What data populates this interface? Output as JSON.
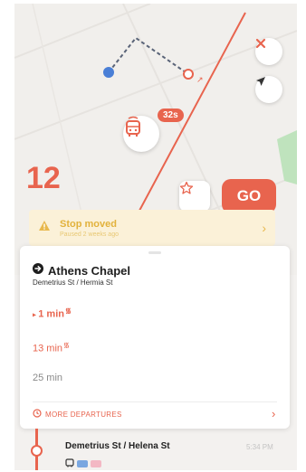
{
  "route": {
    "number": "12"
  },
  "map": {
    "eta_badge": "32s",
    "icons": [
      "close-icon",
      "navigation-arrow-icon",
      "bus-icon"
    ]
  },
  "actions": {
    "go_label": "GO",
    "favorite_icon": "star-icon"
  },
  "alert": {
    "title": "Stop moved",
    "subtitle": "Paused 2 weeks ago",
    "icon": "warning-icon"
  },
  "stop": {
    "name": "Athens Chapel",
    "cross_streets": "Demetrius St / Hermia St",
    "icon": "arrow-circle-icon"
  },
  "departures": [
    {
      "time": "1 min",
      "realtime": true
    },
    {
      "time": "13 min",
      "realtime": true
    },
    {
      "time": "25 min",
      "realtime": false
    }
  ],
  "more_departures": {
    "label": "MORE DEPARTURES",
    "icon": "clock-icon"
  },
  "next_stop": {
    "name": "Demetrius St / Helena St",
    "time": "5:34 PM",
    "icon": "bus-small-icon"
  },
  "colors": {
    "accent": "#e8644e",
    "alert_bg": "#fbf1d8",
    "alert_text": "#e2b23c",
    "map_bg": "#f1efec"
  }
}
